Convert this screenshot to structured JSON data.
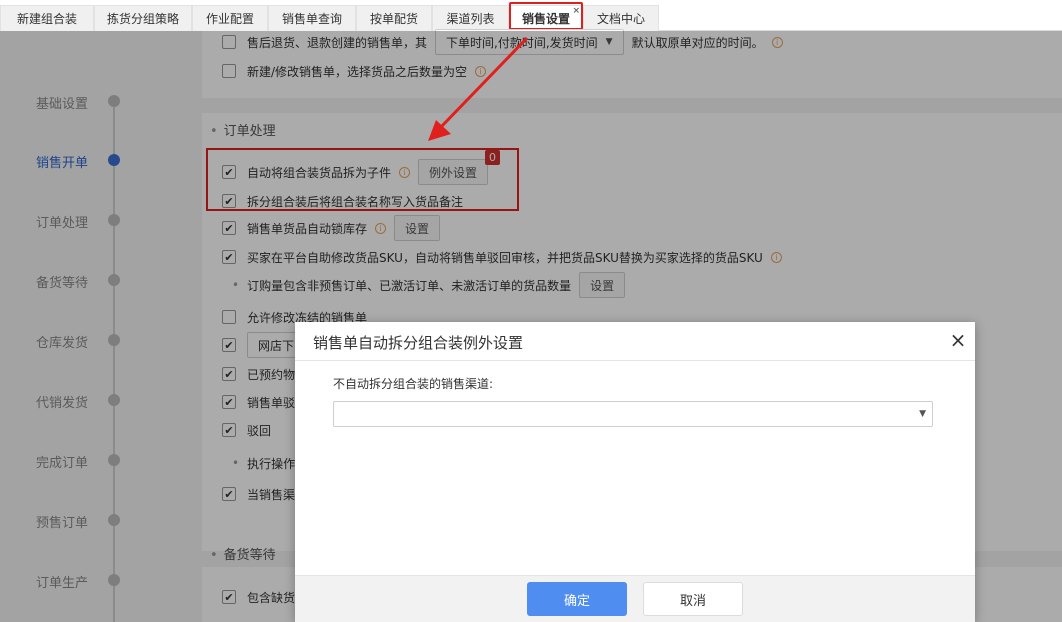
{
  "tabs": [
    {
      "label": "新建组合装"
    },
    {
      "label": "拣货分组策略"
    },
    {
      "label": "作业配置"
    },
    {
      "label": "销售单查询"
    },
    {
      "label": "按单配货"
    },
    {
      "label": "渠道列表"
    },
    {
      "label": "销售设置",
      "active": true,
      "close": "×"
    },
    {
      "label": "文档中心"
    }
  ],
  "sidebar": {
    "items": [
      {
        "label": "基础设置"
      },
      {
        "label": "销售开单",
        "active": true
      },
      {
        "label": "订单处理"
      },
      {
        "label": "备货等待"
      },
      {
        "label": "仓库发货"
      },
      {
        "label": "代销发货"
      },
      {
        "label": "完成订单"
      },
      {
        "label": "预售订单"
      },
      {
        "label": "订单生产"
      }
    ]
  },
  "top_section": {
    "row1_text_a": "售后退货、退款创建的销售单，其",
    "row1_select_value": "下单时间,付款时间,发货时间",
    "row1_text_b": "默认取原单对应的时间。",
    "row2_text": "新建/修改销售单，选择货品之后数量为空"
  },
  "order_section": {
    "title": "订单处理",
    "auto_split": {
      "label": "自动将组合装货品拆为子件",
      "checked": true,
      "button": "例外设置",
      "badge": "0"
    },
    "write_note": {
      "label": "拆分组合装后将组合装名称写入货品备注",
      "checked": true
    },
    "auto_lock": {
      "label": "销售单货品自动锁库存",
      "checked": true,
      "button": "设置"
    },
    "buyer_modify": {
      "label": "买家在平台自助修改货品SKU，自动将销售单驳回审核，并把货品SKU替换为买家选择的货品SKU",
      "checked": true
    },
    "order_qty": {
      "label": "订购量包含非预售订单、已激活订单、未激活订单的货品数量",
      "button": "设置"
    },
    "allow_modify": {
      "label": "允许修改冻结的销售单",
      "checked": false
    },
    "row_shop": {
      "label": "网店下",
      "checked": true
    },
    "row_reserved": {
      "label": "已预约物",
      "checked": true
    },
    "row_reject": {
      "label": "销售单驳",
      "checked": true
    },
    "row_reject2": {
      "label": "驳回",
      "checked": true
    },
    "exec_op": {
      "label": "执行操作"
    },
    "when_sale": {
      "label": "当销售渠",
      "checked": true
    }
  },
  "stock_section": {
    "title": "备货等待",
    "row1": {
      "label": "包含缺货货",
      "checked": true
    }
  },
  "modal": {
    "title": "销售单自动拆分组合装例外设置",
    "close": "×",
    "field_label": "不自动拆分组合装的销售渠道:",
    "select_value": "",
    "ok_label": "确定",
    "cancel_label": "取消"
  },
  "colors": {
    "accent": "#4f8ef0",
    "highlight": "#e0201c",
    "active_nav": "#2e66d0"
  }
}
